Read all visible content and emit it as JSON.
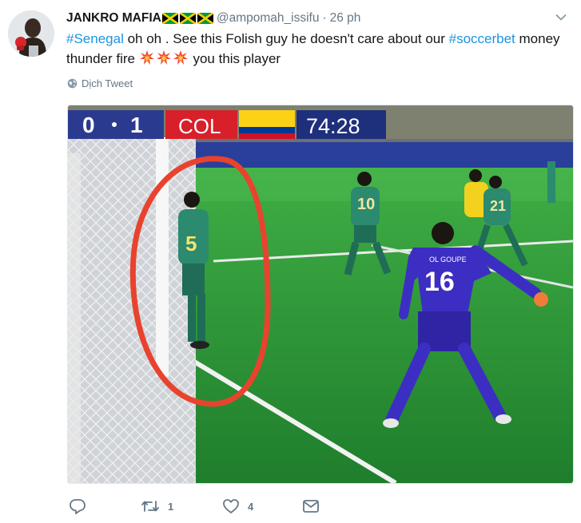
{
  "tweet": {
    "display_name": "JANKRO MAFIA",
    "handle": "@ampomah_issifu",
    "dot": "·",
    "time": "26 ph",
    "text": {
      "hashtag1": "#Senegal",
      "part1": " oh oh . See this Folish guy he doesn't care about our ",
      "hashtag2": "#soccerbet",
      "part2": " money thunder fire ",
      "part3": " you this player"
    },
    "translate_label": "Dịch Tweet"
  },
  "media": {
    "scoreboard": {
      "home_score": "0",
      "away_score": "1",
      "team": "COL",
      "clock": "74:28"
    },
    "player_numbers": [
      "5",
      "10",
      "16",
      "21"
    ],
    "goalkeeper_name_band": "OL GOUPE"
  },
  "actions": {
    "retweet_count": "1",
    "like_count": "4"
  },
  "colors": {
    "link": "#1b95e0",
    "muted": "#657786",
    "pitch": "#2f9a3a",
    "circle": "#e8432e"
  }
}
